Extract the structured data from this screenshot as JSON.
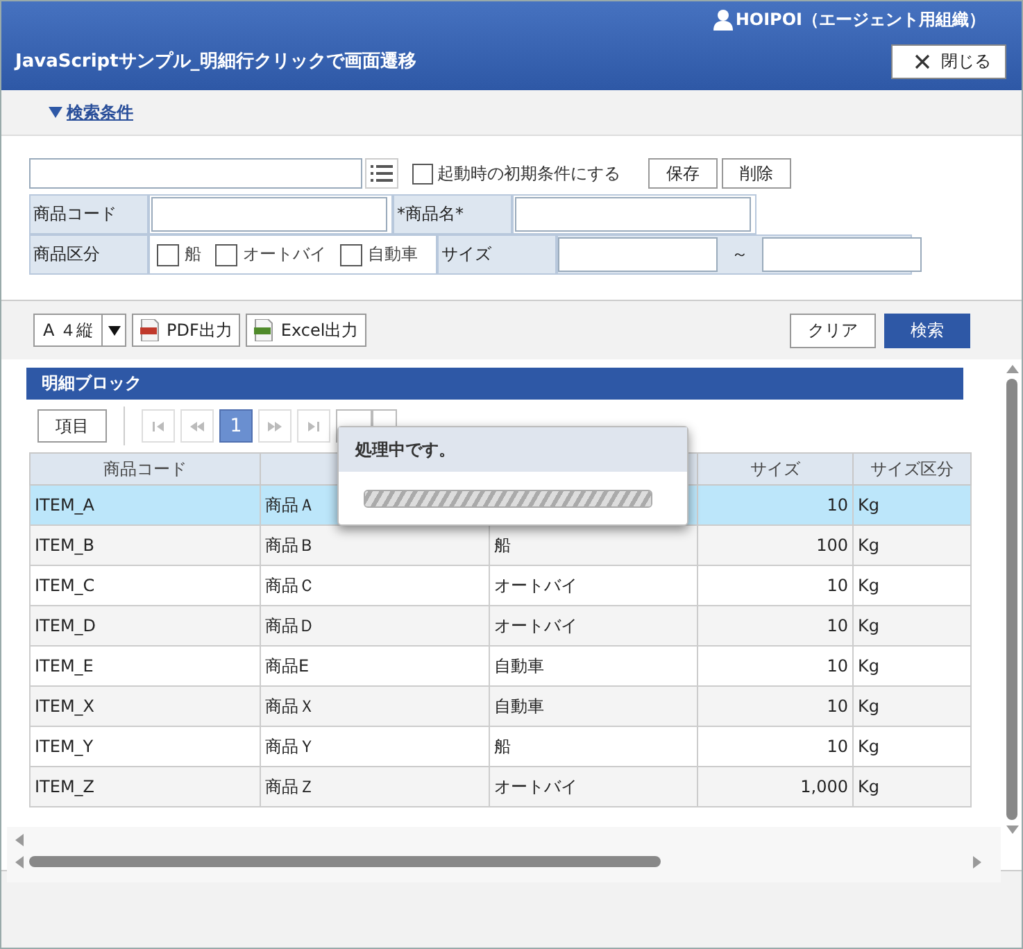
{
  "header": {
    "user": "HOIPOI（エージェント用組織）",
    "title": "JavaScriptサンプル_明細行クリックで画面遷移",
    "close_button": "閉じる"
  },
  "search_toggle": {
    "label": "検索条件",
    "expanded": true
  },
  "search": {
    "initial_condition": {
      "label": "起動時の初期条件にする",
      "checked": false
    },
    "buttons": [
      "保存",
      "削除"
    ],
    "code_label": "商品コード",
    "name_label": "*商品名*",
    "category_label": "商品区分",
    "categories": [
      {
        "label": "船",
        "checked": false
      },
      {
        "label": "オートバイ",
        "checked": false
      },
      {
        "label": "自動車",
        "checked": false
      }
    ],
    "size_label": "サイズ",
    "range_separator": "～"
  },
  "toolbar": {
    "paper": "A ４縦",
    "buttons": [
      {
        "label": "PDF出力",
        "kind": "pdf"
      },
      {
        "label": "Excel出力",
        "kind": "excel"
      }
    ],
    "actions": [
      {
        "label": "クリア",
        "kind": "plain"
      },
      {
        "label": "検索",
        "kind": "primary"
      }
    ]
  },
  "detail": {
    "title": "明細ブロック",
    "items_button": "項目",
    "pages": [
      {
        "label": "1",
        "selected": true
      }
    ],
    "columns": [
      {
        "label": "商品コード"
      },
      {},
      {},
      {
        "label": "サイズ"
      },
      {
        "label": "サイズ区分"
      }
    ],
    "rows": [
      {
        "code": "ITEM_A",
        "name": "商品Ａ",
        "size": "10",
        "unit": "Kg",
        "selected": true
      },
      {
        "code": "ITEM_B",
        "name": "商品Ｂ",
        "category": "船",
        "size": "100",
        "unit": "Kg",
        "selected": false
      },
      {
        "code": "ITEM_C",
        "name": "商品Ｃ",
        "category": "オートバイ",
        "size": "10",
        "unit": "Kg",
        "selected": false
      },
      {
        "code": "ITEM_D",
        "name": "商品Ｄ",
        "category": "オートバイ",
        "size": "10",
        "unit": "Kg",
        "selected": false
      },
      {
        "code": "ITEM_E",
        "name": "商品E",
        "category": "自動車",
        "size": "10",
        "unit": "Kg",
        "selected": false
      },
      {
        "code": "ITEM_X",
        "name": "商品Ｘ",
        "category": "自動車",
        "size": "10",
        "unit": "Kg",
        "selected": false
      },
      {
        "code": "ITEM_Y",
        "name": "商品Ｙ",
        "category": "船",
        "size": "10",
        "unit": "Kg",
        "selected": false
      },
      {
        "code": "ITEM_Z",
        "name": "商品Ｚ",
        "category": "オートバイ",
        "size": "1,000",
        "unit": "Kg",
        "selected": false
      }
    ]
  },
  "dialog": {
    "message": "処理中です。",
    "level": 1
  }
}
